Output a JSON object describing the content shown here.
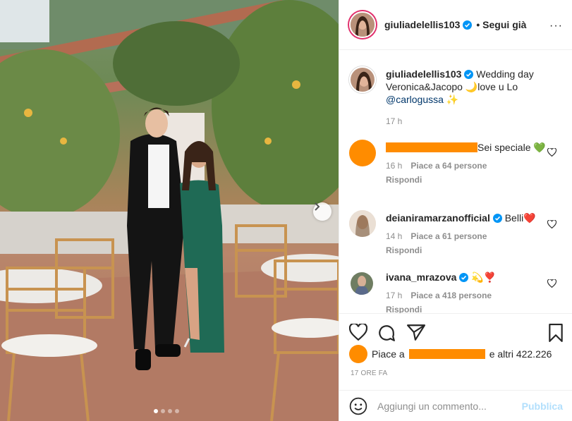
{
  "post": {
    "username": "giuliadelellis103",
    "follow_label": "• Segui già",
    "more_label": "···"
  },
  "caption": {
    "username": "giuliadelellis103",
    "text_before": " Wedding day Veronica&Jacopo 🌙love u Lo ",
    "mention": "@carlogussa",
    "text_after": " ✨",
    "time": "17 h"
  },
  "comments": [
    {
      "username_redacted": true,
      "text": "Sei speciale 💚",
      "time": "16 h",
      "likes": "Piace a 64 persone",
      "reply": "Rispondi"
    },
    {
      "username": "deianiramarzanofficial",
      "text": "Belli❤️",
      "time": "14 h",
      "likes": "Piace a 61 persone",
      "reply": "Rispondi"
    },
    {
      "username": "ivana_mrazova",
      "text": "💫❣️",
      "time": "17 h",
      "likes": "Piace a 418 persone",
      "reply": "Rispondi"
    }
  ],
  "likes": {
    "prefix": "Piace a",
    "suffix": "e altri 422.226"
  },
  "timestamp": "17 ORE FA",
  "composer": {
    "placeholder": "Aggiungi un commento...",
    "publish_label": "Pubblica"
  },
  "carousel": {
    "total_slides": 4,
    "active_slide": 1
  },
  "colors": {
    "verified": "#0095f6",
    "redaction": "#ff8c00",
    "publish_disabled": "#b2dffc"
  },
  "icons": [
    "heart-icon",
    "comment-icon",
    "share-icon",
    "bookmark-icon",
    "emoji-icon",
    "verified-icon",
    "chevron-right-icon"
  ]
}
